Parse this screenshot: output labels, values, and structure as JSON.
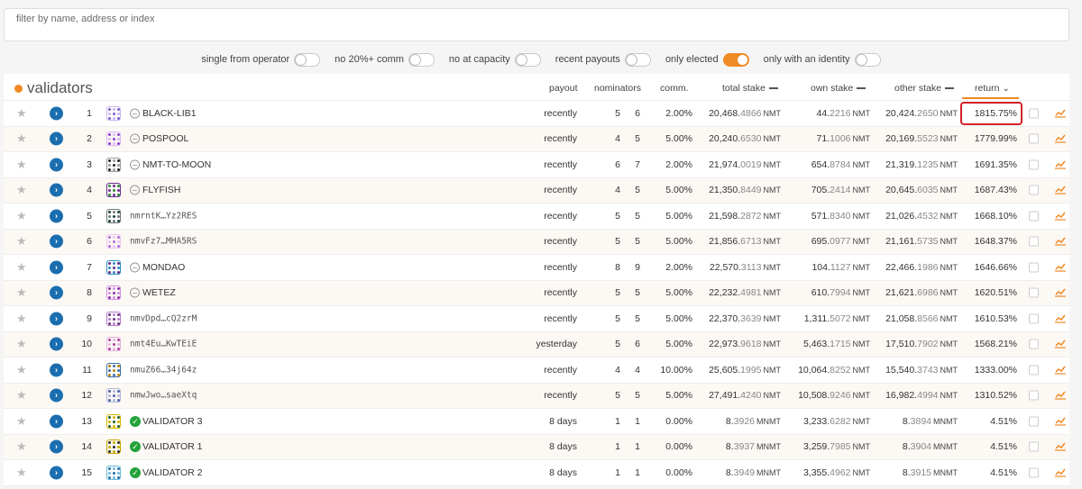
{
  "filter": {
    "placeholder": "filter by name, address or index"
  },
  "toggles": [
    {
      "label": "single from operator",
      "on": false
    },
    {
      "label": "no 20%+ comm",
      "on": false
    },
    {
      "label": "no at capacity",
      "on": false
    },
    {
      "label": "recent payouts",
      "on": false
    },
    {
      "label": "only elected",
      "on": true
    },
    {
      "label": "only with an identity",
      "on": false
    }
  ],
  "table": {
    "title": "validators",
    "headers": {
      "payout": "payout",
      "nominators": "nominators",
      "comm": "comm.",
      "total_stake": "total stake",
      "own_stake": "own stake",
      "other_stake": "other stake",
      "return": "return"
    },
    "rows": [
      {
        "index": "1",
        "name": "BLACK-LIB1",
        "kind": "name",
        "payout": "recently",
        "n1": "5",
        "n2": "6",
        "comm": "2.00%",
        "ts_int": "20,468.",
        "ts_dec": "4866",
        "ts_unit": "NMT",
        "os_int": "44.",
        "os_dec": "2216",
        "os_unit": "NMT",
        "xs_int": "20,424.",
        "xs_dec": "2650",
        "xs_unit": "NMT",
        "ret": "1815.75%",
        "highlight": true,
        "colors": [
          "#7a5cc9",
          "#c9b6f2"
        ]
      },
      {
        "index": "2",
        "name": "POSPOOL",
        "kind": "name",
        "payout": "recently",
        "n1": "4",
        "n2": "5",
        "comm": "5.00%",
        "ts_int": "20,240.",
        "ts_dec": "6530",
        "ts_unit": "NMT",
        "os_int": "71.",
        "os_dec": "1006",
        "os_unit": "NMT",
        "xs_int": "20,169.",
        "xs_dec": "5523",
        "xs_unit": "NMT",
        "ret": "1779.99%",
        "highlight": false,
        "colors": [
          "#8a3fd1",
          "#d8b8f5"
        ]
      },
      {
        "index": "3",
        "name": "NMT-TO-MOON",
        "kind": "name",
        "payout": "recently",
        "n1": "6",
        "n2": "7",
        "comm": "2.00%",
        "ts_int": "21,974.",
        "ts_dec": "0019",
        "ts_unit": "NMT",
        "os_int": "654.",
        "os_dec": "8784",
        "os_unit": "NMT",
        "xs_int": "21,319.",
        "xs_dec": "1235",
        "xs_unit": "NMT",
        "ret": "1691.35%",
        "highlight": false,
        "colors": [
          "#222222",
          "#9a9a9a"
        ]
      },
      {
        "index": "4",
        "name": "FLYFISH",
        "kind": "name",
        "payout": "recently",
        "n1": "4",
        "n2": "5",
        "comm": "5.00%",
        "ts_int": "21,350.",
        "ts_dec": "8449",
        "ts_unit": "NMT",
        "os_int": "705.",
        "os_dec": "2414",
        "os_unit": "NMT",
        "xs_int": "20,645.",
        "xs_dec": "6035",
        "xs_unit": "NMT",
        "ret": "1687.43%",
        "highlight": false,
        "colors": [
          "#2d8a3a",
          "#6a2f8f"
        ]
      },
      {
        "index": "5",
        "name": "nmrntK…Yz2RES",
        "kind": "addr",
        "payout": "recently",
        "n1": "5",
        "n2": "5",
        "comm": "5.00%",
        "ts_int": "21,598.",
        "ts_dec": "2872",
        "ts_unit": "NMT",
        "os_int": "571.",
        "os_dec": "8340",
        "os_unit": "NMT",
        "xs_int": "21,026.",
        "xs_dec": "4532",
        "xs_unit": "NMT",
        "ret": "1668.10%",
        "highlight": false,
        "colors": [
          "#1d3d3a",
          "#6d7b79"
        ]
      },
      {
        "index": "6",
        "name": "nmvFz7…MHA5RS",
        "kind": "addr",
        "payout": "recently",
        "n1": "5",
        "n2": "5",
        "comm": "5.00%",
        "ts_int": "21,856.",
        "ts_dec": "6713",
        "ts_unit": "NMT",
        "os_int": "695.",
        "os_dec": "0977",
        "os_unit": "NMT",
        "xs_int": "21,161.",
        "xs_dec": "5735",
        "xs_unit": "NMT",
        "ret": "1648.37%",
        "highlight": false,
        "colors": [
          "#b06bd6",
          "#e8c6f5"
        ]
      },
      {
        "index": "7",
        "name": "MONDAO",
        "kind": "name",
        "payout": "recently",
        "n1": "8",
        "n2": "9",
        "comm": "2.00%",
        "ts_int": "22,570.",
        "ts_dec": "3113",
        "ts_unit": "NMT",
        "os_int": "104.",
        "os_dec": "1127",
        "os_unit": "NMT",
        "xs_int": "22,466.",
        "xs_dec": "1986",
        "xs_unit": "NMT",
        "ret": "1646.66%",
        "highlight": false,
        "colors": [
          "#5a2a8a",
          "#2f8bc7"
        ]
      },
      {
        "index": "8",
        "name": "WETEZ",
        "kind": "name",
        "payout": "recently",
        "n1": "5",
        "n2": "5",
        "comm": "5.00%",
        "ts_int": "22,232.",
        "ts_dec": "4981",
        "ts_unit": "NMT",
        "os_int": "610.",
        "os_dec": "7994",
        "os_unit": "NMT",
        "xs_int": "21,621.",
        "xs_dec": "6986",
        "xs_unit": "NMT",
        "ret": "1620.51%",
        "highlight": false,
        "colors": [
          "#8b2fa8",
          "#d08ee6"
        ]
      },
      {
        "index": "9",
        "name": "nmvDpd…cQ2zrM",
        "kind": "addr",
        "payout": "recently",
        "n1": "5",
        "n2": "5",
        "comm": "5.00%",
        "ts_int": "22,370.",
        "ts_dec": "3639",
        "ts_unit": "NMT",
        "os_int": "1,311.",
        "os_dec": "5072",
        "os_unit": "NMT",
        "xs_int": "21,058.",
        "xs_dec": "8566",
        "xs_unit": "NMT",
        "ret": "1610.53%",
        "highlight": false,
        "colors": [
          "#6a2f7a",
          "#b57ccc"
        ]
      },
      {
        "index": "10",
        "name": "nmt4Eu…KwTEiE",
        "kind": "addr",
        "payout": "yesterday",
        "n1": "5",
        "n2": "6",
        "comm": "5.00%",
        "ts_int": "22,973.",
        "ts_dec": "9618",
        "ts_unit": "NMT",
        "os_int": "5,463.",
        "os_dec": "1715",
        "os_unit": "NMT",
        "xs_int": "17,510.",
        "xs_dec": "7902",
        "xs_unit": "NMT",
        "ret": "1568.21%",
        "highlight": false,
        "colors": [
          "#b03fa6",
          "#e3b3dd"
        ]
      },
      {
        "index": "11",
        "name": "nmuZ66…34j64z",
        "kind": "addr",
        "payout": "recently",
        "n1": "4",
        "n2": "4",
        "comm": "10.00%",
        "ts_int": "25,605.",
        "ts_dec": "1995",
        "ts_unit": "NMT",
        "os_int": "10,064.",
        "os_dec": "8252",
        "os_unit": "NMT",
        "xs_int": "15,540.",
        "xs_dec": "3743",
        "xs_unit": "NMT",
        "ret": "1333.00%",
        "highlight": false,
        "colors": [
          "#b8860b",
          "#3c6ea8"
        ]
      },
      {
        "index": "12",
        "name": "nmwJwo…saeXtq",
        "kind": "addr",
        "payout": "recently",
        "n1": "5",
        "n2": "5",
        "comm": "5.00%",
        "ts_int": "27,491.",
        "ts_dec": "4240",
        "ts_unit": "NMT",
        "os_int": "10,508.",
        "os_dec": "9246",
        "os_unit": "NMT",
        "xs_int": "16,982.",
        "xs_dec": "4994",
        "xs_unit": "NMT",
        "ret": "1310.52%",
        "highlight": false,
        "colors": [
          "#4a5fa8",
          "#b2b8d8"
        ]
      },
      {
        "index": "13",
        "name": "VALIDATOR 3",
        "kind": "verified",
        "payout": "8 days",
        "n1": "1",
        "n2": "1",
        "comm": "0.00%",
        "ts_int": "8.",
        "ts_dec": "3926",
        "ts_unit": "MNMT",
        "os_int": "3,233.",
        "os_dec": "6282",
        "os_unit": "NMT",
        "xs_int": "8.",
        "xs_dec": "3894",
        "xs_unit": "MNMT",
        "ret": "4.51%",
        "highlight": false,
        "colors": [
          "#1f5a2a",
          "#d4b400"
        ]
      },
      {
        "index": "14",
        "name": "VALIDATOR 1",
        "kind": "verified",
        "payout": "8 days",
        "n1": "1",
        "n2": "1",
        "comm": "0.00%",
        "ts_int": "8.",
        "ts_dec": "3937",
        "ts_unit": "MNMT",
        "os_int": "3,259.",
        "os_dec": "7985",
        "os_unit": "NMT",
        "xs_int": "8.",
        "xs_dec": "3904",
        "xs_unit": "MNMT",
        "ret": "4.51%",
        "highlight": false,
        "colors": [
          "#2a2a2a",
          "#c9a800"
        ]
      },
      {
        "index": "15",
        "name": "VALIDATOR 2",
        "kind": "verified",
        "payout": "8 days",
        "n1": "1",
        "n2": "1",
        "comm": "0.00%",
        "ts_int": "8.",
        "ts_dec": "3949",
        "ts_unit": "MNMT",
        "os_int": "3,355.",
        "os_dec": "4962",
        "os_unit": "NMT",
        "xs_int": "8.",
        "xs_dec": "3915",
        "xs_unit": "MNMT",
        "ret": "4.51%",
        "highlight": false,
        "colors": [
          "#1f6fa8",
          "#6ab8d8"
        ]
      }
    ]
  },
  "icons": {
    "star": "star-icon",
    "expand": "chevron-right-icon",
    "chart": "chart-icon"
  },
  "colors": {
    "accent": "#f08a24",
    "expand_button": "#1a6eaf",
    "highlight_border": "#d61f26",
    "verified": "#23a23a"
  }
}
